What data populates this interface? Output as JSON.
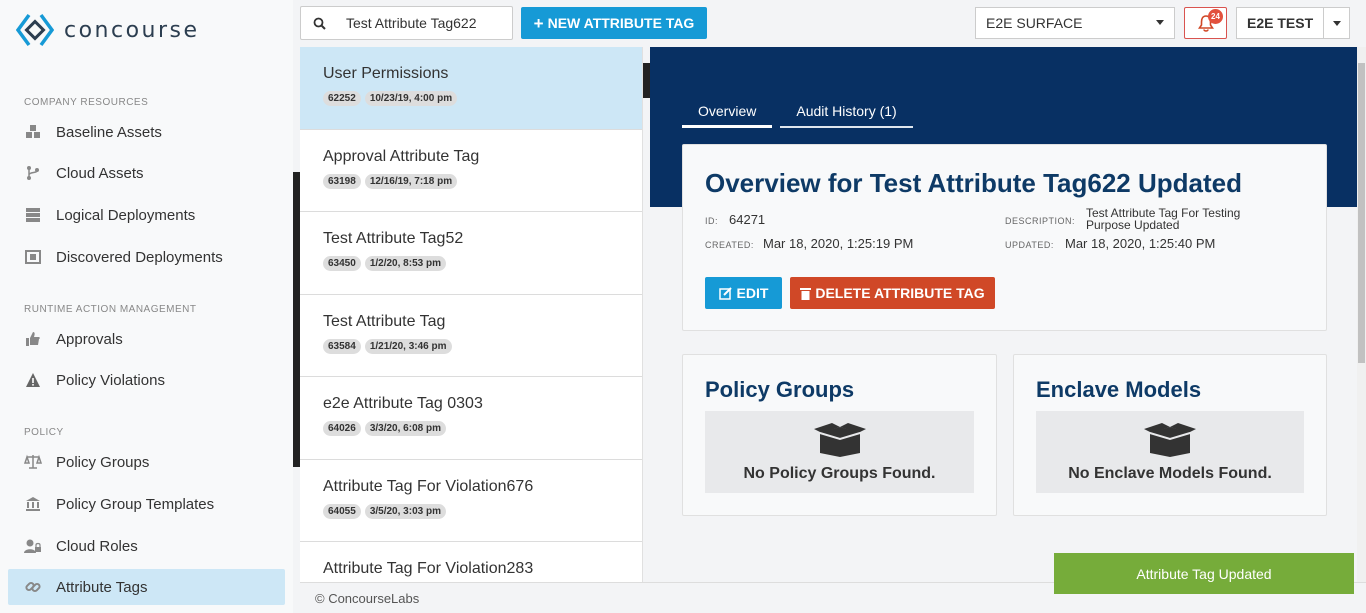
{
  "app": {
    "logo_text": "concourse"
  },
  "sidebar": {
    "sections": [
      {
        "title": "COMPANY RESOURCES"
      },
      {
        "title": "RUNTIME ACTION MANAGEMENT"
      },
      {
        "title": "POLICY"
      }
    ],
    "items": [
      {
        "label": "Baseline Assets",
        "icon": "cubes-icon"
      },
      {
        "label": "Cloud Assets",
        "icon": "branch-icon"
      },
      {
        "label": "Logical Deployments",
        "icon": "server-icon"
      },
      {
        "label": "Discovered Deployments",
        "icon": "scan-icon"
      },
      {
        "label": "Approvals",
        "icon": "thumbs-up-icon"
      },
      {
        "label": "Policy Violations",
        "icon": "warning-icon"
      },
      {
        "label": "Policy Groups",
        "icon": "balance-scale-icon"
      },
      {
        "label": "Policy Group Templates",
        "icon": "bank-icon"
      },
      {
        "label": "Cloud Roles",
        "icon": "user-lock-icon"
      },
      {
        "label": "Attribute Tags",
        "icon": "link-icon",
        "active": true
      }
    ]
  },
  "topbar": {
    "search_value": "Test Attribute Tag622",
    "new_button": "NEW ATTRIBUTE TAG",
    "surface_select": "E2E SURFACE",
    "notifications_count": "24",
    "user_label": "E2E TEST"
  },
  "list": {
    "items": [
      {
        "title": "User Permissions",
        "id": "62252",
        "date": "10/23/19, 4:00 pm",
        "active": true
      },
      {
        "title": "Approval Attribute Tag",
        "id": "63198",
        "date": "12/16/19, 7:18 pm"
      },
      {
        "title": "Test Attribute Tag52",
        "id": "63450",
        "date": "1/2/20, 8:53 pm"
      },
      {
        "title": "Test Attribute Tag",
        "id": "63584",
        "date": "1/21/20, 3:46 pm"
      },
      {
        "title": "e2e Attribute Tag 0303",
        "id": "64026",
        "date": "3/3/20, 6:08 pm"
      },
      {
        "title": "Attribute Tag For Violation676",
        "id": "64055",
        "date": "3/5/20, 3:03 pm"
      },
      {
        "title": "Attribute Tag For Violation283",
        "id": "",
        "date": ""
      }
    ]
  },
  "detail": {
    "tabs": [
      "Overview",
      "Audit History (1)"
    ],
    "title": "Overview for Test Attribute Tag622 Updated",
    "id_label": "ID:",
    "id_value": "64271",
    "created_label": "CREATED:",
    "created_value": "Mar 18, 2020, 1:25:19 PM",
    "description_label": "DESCRIPTION:",
    "description_value": "Test Attribute Tag For Testing Purpose Updated",
    "updated_label": "UPDATED:",
    "updated_value": "Mar 18, 2020, 1:25:40 PM",
    "edit_button": "EDIT",
    "delete_button": "DELETE ATTRIBUTE TAG",
    "policy_groups_title": "Policy Groups",
    "policy_groups_empty": "No Policy Groups Found.",
    "enclave_models_title": "Enclave Models",
    "enclave_models_empty": "No Enclave Models Found."
  },
  "footer": {
    "text": "© ConcourseLabs"
  },
  "toast": {
    "text": "Attribute Tag Updated"
  },
  "colors": {
    "primary": "#169ad6",
    "danger": "#d04827",
    "navy": "#083063",
    "success": "#76ac3a"
  }
}
